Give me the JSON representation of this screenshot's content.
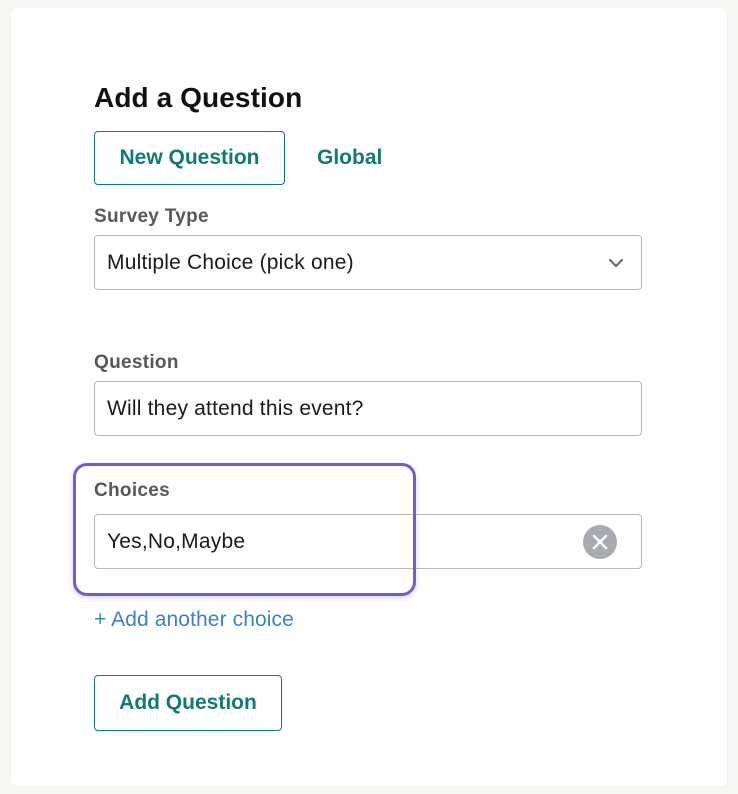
{
  "form": {
    "title": "Add a Question",
    "tabs": {
      "new_question": "New Question",
      "global": "Global"
    },
    "survey_type": {
      "label": "Survey Type",
      "value": "Multiple Choice (pick one)"
    },
    "question": {
      "label": "Question",
      "value": "Will they attend this event?"
    },
    "choices": {
      "label": "Choices",
      "value": "Yes,No,Maybe"
    },
    "add_choice_link": "+ Add another choice",
    "submit_label": "Add Question"
  },
  "colors": {
    "accent": "#0f7b73",
    "link": "#3b83c7",
    "highlight": "#6c5fd1",
    "label": "#55595c"
  },
  "icons": {
    "dropdown": "chevron-down-icon",
    "clear": "close-icon"
  }
}
